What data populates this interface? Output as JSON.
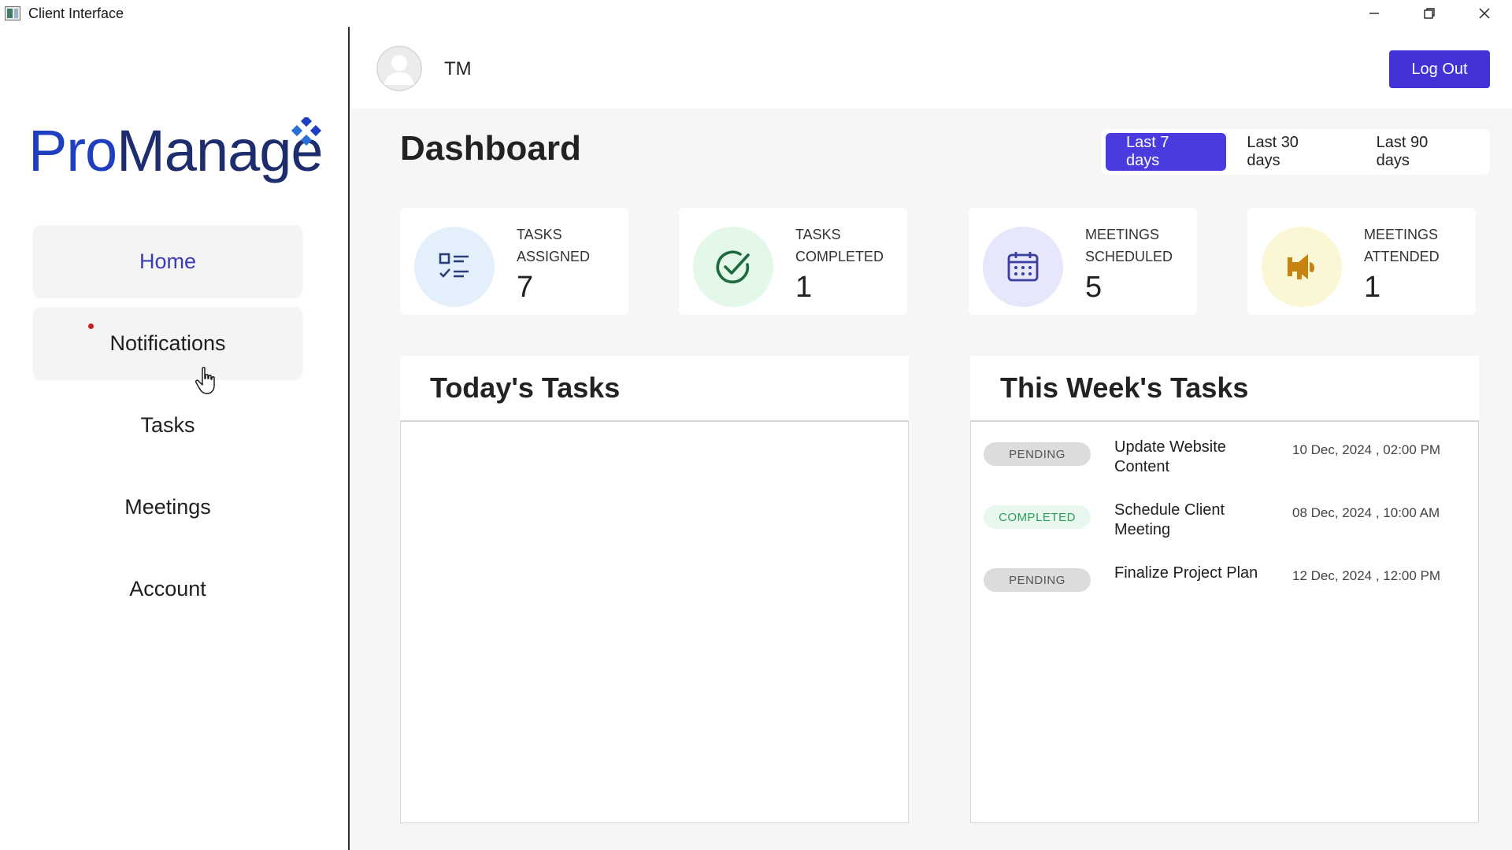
{
  "window": {
    "title": "Client Interface",
    "controls": [
      "minimize",
      "restore",
      "close"
    ]
  },
  "brand": {
    "logo_pro": "Pro",
    "logo_manage": "Manage",
    "pro_color": "#1e3fbf",
    "manage_color": "#1d2d6e"
  },
  "sidebar": {
    "items": [
      {
        "label": "Home",
        "active": true
      },
      {
        "label": "Notifications",
        "has_unread": true
      },
      {
        "label": "Tasks"
      },
      {
        "label": "Meetings"
      },
      {
        "label": "Account"
      }
    ]
  },
  "header": {
    "user_initials": "TM",
    "logout_label": "Log Out"
  },
  "dashboard": {
    "title": "Dashboard",
    "ranges": [
      {
        "label": "Last 7 days",
        "active": true
      },
      {
        "label": "Last 30 days"
      },
      {
        "label": "Last 90 days"
      }
    ],
    "stats": [
      {
        "label_line1": "Tasks",
        "label_line2": "Assigned",
        "value": "7",
        "icon": "task-list-icon",
        "bg": "#e3f0fb"
      },
      {
        "label_line1": "Tasks",
        "label_line2": "Completed",
        "value": "1",
        "icon": "check-circle-icon",
        "bg": "#e4f8ea"
      },
      {
        "label_line1": "Meetings",
        "label_line2": "Scheduled",
        "value": "5",
        "icon": "calendar-icon",
        "bg": "#e6e7fa"
      },
      {
        "label_line1": "Meetings",
        "label_line2": "Attended",
        "value": "1",
        "icon": "megaphone-icon",
        "bg": "#fbf6d6"
      }
    ]
  },
  "today_tasks": {
    "title": "Today's Tasks",
    "items": []
  },
  "week_tasks": {
    "title": "This Week's Tasks",
    "items": [
      {
        "status": "PENDING",
        "title": "Update Website Content",
        "date": "10 Dec, 2024 , 02:00 PM"
      },
      {
        "status": "COMPLETED",
        "title": "Schedule Client Meeting",
        "date": "08 Dec, 2024 , 10:00 AM"
      },
      {
        "status": "PENDING",
        "title": "Finalize Project Plan",
        "date": "12 Dec, 2024 , 12:00 PM"
      }
    ]
  },
  "colors": {
    "accent": "#4a3bdf",
    "logout": "#4332d6",
    "nav_active_text": "#3b3bb5",
    "notification_dot": "#cc1d1d"
  }
}
